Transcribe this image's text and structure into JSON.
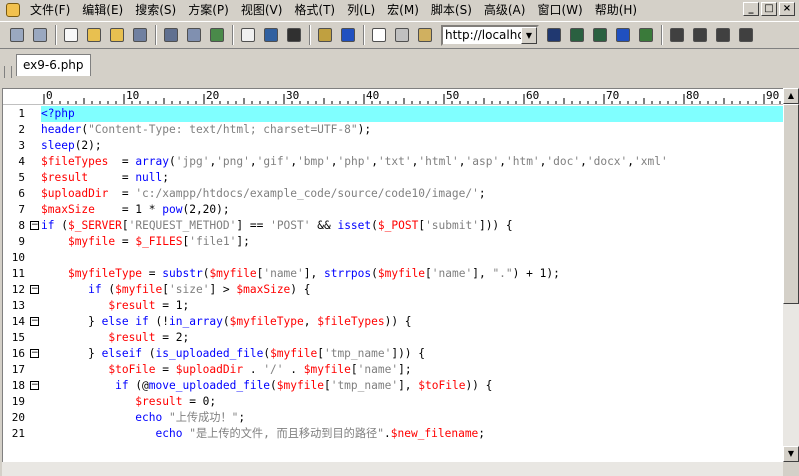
{
  "menu": [
    "文件(F)",
    "编辑(E)",
    "搜索(S)",
    "方案(P)",
    "视图(V)",
    "格式(T)",
    "列(L)",
    "宏(M)",
    "脚本(S)",
    "高级(A)",
    "窗口(W)",
    "帮助(H)"
  ],
  "window_controls": [
    "_",
    "□",
    "×"
  ],
  "toolbar": {
    "icons": [
      "back-icon",
      "forward-icon",
      "new-file-icon",
      "open-folder-icon",
      "open-icon",
      "save-icon",
      "print-icon",
      "print-preview-icon",
      "spell-check-icon",
      "page-icon",
      "wrap-icon",
      "hex-icon",
      "bookmark-icon",
      "browser-icon",
      "cursor-icon",
      "copy-icon",
      "paste-icon"
    ],
    "url_value": "http://localhos",
    "right_icons": [
      "find-icon",
      "find-next-icon",
      "find-prev-icon",
      "replace-icon",
      "goto-icon",
      "align-left-icon",
      "align-center-icon",
      "align-right-icon",
      "more-icon"
    ]
  },
  "tab": {
    "label": "ex9-6.php"
  },
  "ruler": {
    "labels": [
      "0",
      "10",
      "20",
      "30",
      "40",
      "50",
      "60",
      "70",
      "80",
      "90"
    ]
  },
  "colors": {
    "keyword": "#0000ff",
    "variable": "#ff0000",
    "string": "#808080",
    "active_line": "#80ffff"
  },
  "lines": [
    {
      "n": "1",
      "fold": false,
      "active": true,
      "tokens": [
        [
          "k",
          "<?php"
        ]
      ]
    },
    {
      "n": "2",
      "fold": false,
      "tokens": [
        [
          "k",
          "header"
        ],
        [
          "t",
          "("
        ],
        [
          "s",
          "\"Content-Type: text/html; charset=UTF-8\""
        ],
        [
          "t",
          ");"
        ]
      ]
    },
    {
      "n": "3",
      "fold": false,
      "tokens": [
        [
          "k",
          "sleep"
        ],
        [
          "t",
          "(2);"
        ]
      ]
    },
    {
      "n": "4",
      "fold": false,
      "tokens": [
        [
          "v",
          "$fileTypes"
        ],
        [
          "t",
          "  = "
        ],
        [
          "k",
          "array"
        ],
        [
          "t",
          "("
        ],
        [
          "s",
          "'jpg'"
        ],
        [
          "t",
          ","
        ],
        [
          "s",
          "'png'"
        ],
        [
          "t",
          ","
        ],
        [
          "s",
          "'gif'"
        ],
        [
          "t",
          ","
        ],
        [
          "s",
          "'bmp'"
        ],
        [
          "t",
          ","
        ],
        [
          "s",
          "'php'"
        ],
        [
          "t",
          ","
        ],
        [
          "s",
          "'txt'"
        ],
        [
          "t",
          ","
        ],
        [
          "s",
          "'html'"
        ],
        [
          "t",
          ","
        ],
        [
          "s",
          "'asp'"
        ],
        [
          "t",
          ","
        ],
        [
          "s",
          "'htm'"
        ],
        [
          "t",
          ","
        ],
        [
          "s",
          "'doc'"
        ],
        [
          "t",
          ","
        ],
        [
          "s",
          "'docx'"
        ],
        [
          "t",
          ","
        ],
        [
          "s",
          "'xml'"
        ]
      ]
    },
    {
      "n": "5",
      "fold": false,
      "tokens": [
        [
          "v",
          "$result"
        ],
        [
          "t",
          "     = "
        ],
        [
          "k",
          "null"
        ],
        [
          "t",
          ";"
        ]
      ]
    },
    {
      "n": "6",
      "fold": false,
      "tokens": [
        [
          "v",
          "$uploadDir"
        ],
        [
          "t",
          "  = "
        ],
        [
          "s",
          "'c:/xampp/htdocs/example_code/source/code10/image/'"
        ],
        [
          "t",
          ";"
        ]
      ]
    },
    {
      "n": "7",
      "fold": false,
      "tokens": [
        [
          "v",
          "$maxSize"
        ],
        [
          "t",
          "    = 1 * "
        ],
        [
          "k",
          "pow"
        ],
        [
          "t",
          "(2,20);"
        ]
      ]
    },
    {
      "n": "8",
      "fold": true,
      "tokens": [
        [
          "k",
          "if"
        ],
        [
          "t",
          " ("
        ],
        [
          "v",
          "$_SERVER"
        ],
        [
          "t",
          "["
        ],
        [
          "s",
          "'REQUEST_METHOD'"
        ],
        [
          "t",
          "] == "
        ],
        [
          "s",
          "'POST'"
        ],
        [
          "t",
          " && "
        ],
        [
          "k",
          "isset"
        ],
        [
          "t",
          "("
        ],
        [
          "v",
          "$_POST"
        ],
        [
          "t",
          "["
        ],
        [
          "s",
          "'submit'"
        ],
        [
          "t",
          "])) {"
        ]
      ]
    },
    {
      "n": "9",
      "fold": false,
      "tokens": [
        [
          "t",
          "    "
        ],
        [
          "v",
          "$myfile"
        ],
        [
          "t",
          " = "
        ],
        [
          "v",
          "$_FILES"
        ],
        [
          "t",
          "["
        ],
        [
          "s",
          "'file1'"
        ],
        [
          "t",
          "];"
        ]
      ]
    },
    {
      "n": "10",
      "fold": false,
      "tokens": []
    },
    {
      "n": "11",
      "fold": false,
      "tokens": [
        [
          "t",
          "    "
        ],
        [
          "v",
          "$myfileType"
        ],
        [
          "t",
          " = "
        ],
        [
          "k",
          "substr"
        ],
        [
          "t",
          "("
        ],
        [
          "v",
          "$myfile"
        ],
        [
          "t",
          "["
        ],
        [
          "s",
          "'name'"
        ],
        [
          "t",
          "], "
        ],
        [
          "k",
          "strrpos"
        ],
        [
          "t",
          "("
        ],
        [
          "v",
          "$myfile"
        ],
        [
          "t",
          "["
        ],
        [
          "s",
          "'name'"
        ],
        [
          "t",
          "], "
        ],
        [
          "s",
          "\".\""
        ],
        [
          "t",
          ") + 1);"
        ]
      ]
    },
    {
      "n": "12",
      "fold": true,
      "tokens": [
        [
          "t",
          "       "
        ],
        [
          "k",
          "if"
        ],
        [
          "t",
          " ("
        ],
        [
          "v",
          "$myfile"
        ],
        [
          "t",
          "["
        ],
        [
          "s",
          "'size'"
        ],
        [
          "t",
          "] > "
        ],
        [
          "v",
          "$maxSize"
        ],
        [
          "t",
          ") {"
        ]
      ]
    },
    {
      "n": "13",
      "fold": false,
      "tokens": [
        [
          "t",
          "          "
        ],
        [
          "v",
          "$result"
        ],
        [
          "t",
          " = 1;"
        ]
      ]
    },
    {
      "n": "14",
      "fold": true,
      "tokens": [
        [
          "t",
          "       } "
        ],
        [
          "k",
          "else if"
        ],
        [
          "t",
          " (!"
        ],
        [
          "k",
          "in_array"
        ],
        [
          "t",
          "("
        ],
        [
          "v",
          "$myfileType"
        ],
        [
          "t",
          ", "
        ],
        [
          "v",
          "$fileTypes"
        ],
        [
          "t",
          ")) {"
        ]
      ]
    },
    {
      "n": "15",
      "fold": false,
      "tokens": [
        [
          "t",
          "          "
        ],
        [
          "v",
          "$result"
        ],
        [
          "t",
          " = 2;"
        ]
      ]
    },
    {
      "n": "16",
      "fold": true,
      "tokens": [
        [
          "t",
          "       } "
        ],
        [
          "k",
          "elseif"
        ],
        [
          "t",
          " ("
        ],
        [
          "k",
          "is_uploaded_file"
        ],
        [
          "t",
          "("
        ],
        [
          "v",
          "$myfile"
        ],
        [
          "t",
          "["
        ],
        [
          "s",
          "'tmp_name'"
        ],
        [
          "t",
          "])) {"
        ]
      ]
    },
    {
      "n": "17",
      "fold": false,
      "tokens": [
        [
          "t",
          "          "
        ],
        [
          "v",
          "$toFile"
        ],
        [
          "t",
          " = "
        ],
        [
          "v",
          "$uploadDir"
        ],
        [
          "t",
          " . "
        ],
        [
          "s",
          "'/'"
        ],
        [
          "t",
          " . "
        ],
        [
          "v",
          "$myfile"
        ],
        [
          "t",
          "["
        ],
        [
          "s",
          "'name'"
        ],
        [
          "t",
          "];"
        ]
      ]
    },
    {
      "n": "18",
      "fold": true,
      "tokens": [
        [
          "t",
          "           "
        ],
        [
          "k",
          "if"
        ],
        [
          "t",
          " (@"
        ],
        [
          "k",
          "move_uploaded_file"
        ],
        [
          "t",
          "("
        ],
        [
          "v",
          "$myfile"
        ],
        [
          "t",
          "["
        ],
        [
          "s",
          "'tmp_name'"
        ],
        [
          "t",
          "], "
        ],
        [
          "v",
          "$toFile"
        ],
        [
          "t",
          ")) {"
        ]
      ]
    },
    {
      "n": "19",
      "fold": false,
      "tokens": [
        [
          "t",
          "              "
        ],
        [
          "v",
          "$result"
        ],
        [
          "t",
          " = 0;"
        ]
      ]
    },
    {
      "n": "20",
      "fold": false,
      "tokens": [
        [
          "t",
          "              "
        ],
        [
          "k",
          "echo"
        ],
        [
          "t",
          " "
        ],
        [
          "s",
          "\"上传成功！\""
        ],
        [
          "t",
          ";"
        ]
      ]
    },
    {
      "n": "21",
      "fold": false,
      "tokens": [
        [
          "t",
          "                 "
        ],
        [
          "k",
          "echo"
        ],
        [
          "t",
          " "
        ],
        [
          "s",
          "\"是上传的文件, 而且移动到目的路径\""
        ],
        [
          "t",
          "."
        ],
        [
          "v",
          "$new_filename"
        ],
        [
          "t",
          ";"
        ]
      ]
    }
  ]
}
